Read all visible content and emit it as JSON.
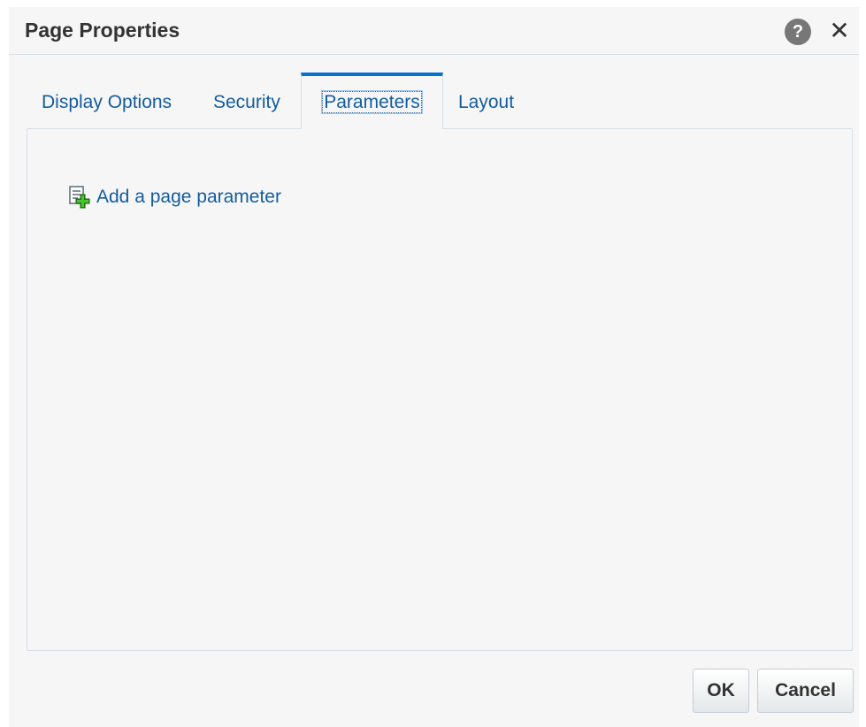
{
  "dialog": {
    "title": "Page Properties",
    "help_icon": "question-circle",
    "help_glyph": "?",
    "close_icon": "close-x",
    "close_glyph": "✕"
  },
  "tabs": [
    {
      "label": "Display Options",
      "active": false
    },
    {
      "label": "Security",
      "active": false
    },
    {
      "label": "Parameters",
      "active": true
    },
    {
      "label": "Layout",
      "active": false
    }
  ],
  "parameters_panel": {
    "add_parameter_label": "Add a page parameter",
    "add_parameter_icon": "add-document"
  },
  "buttons": {
    "ok_label": "OK",
    "cancel_label": "Cancel"
  },
  "colors": {
    "accent": "#0572ce",
    "link": "#145c9e",
    "background": "#f6f6f6"
  }
}
